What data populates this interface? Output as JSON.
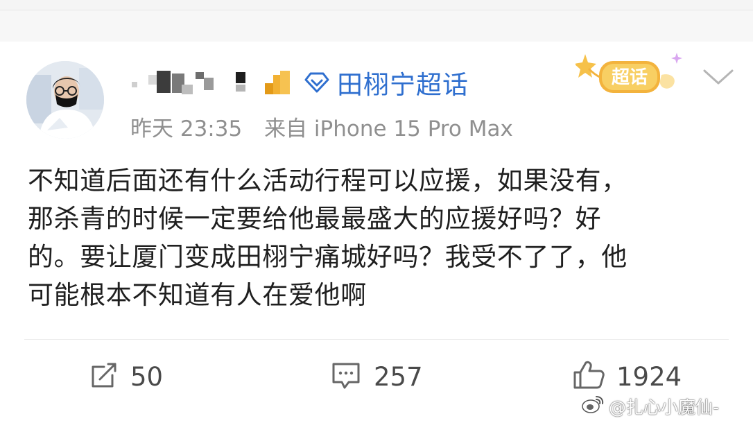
{
  "post": {
    "topic_label": "田栩宁超话",
    "timestamp": "昨天 23:35",
    "source": "来自 iPhone 15 Pro Max",
    "badge_text": "超话",
    "content_lines": [
      "不知道后面还有什么活动行程可以应援，如果没有，",
      "那杀青的时候一定要给他最最盛大的应援好吗？好",
      "的。要让厦门变成田栩宁痛城好吗？我受不了了，他",
      "可能根本不知道有人在爱他啊"
    ]
  },
  "actions": {
    "repost_count": "50",
    "comment_count": "257",
    "like_count": "1924"
  },
  "watermark": {
    "text": "@扎心小魔仙-"
  },
  "colors": {
    "link_blue": "#2f6fcf",
    "meta_gray": "#8f8f8f",
    "badge_gold": "#f3b33d"
  },
  "icons": {
    "topic": "diamond-icon",
    "menu": "chevron-down-icon",
    "repost": "share-icon",
    "comment": "comment-icon",
    "like": "thumbs-up-icon"
  }
}
